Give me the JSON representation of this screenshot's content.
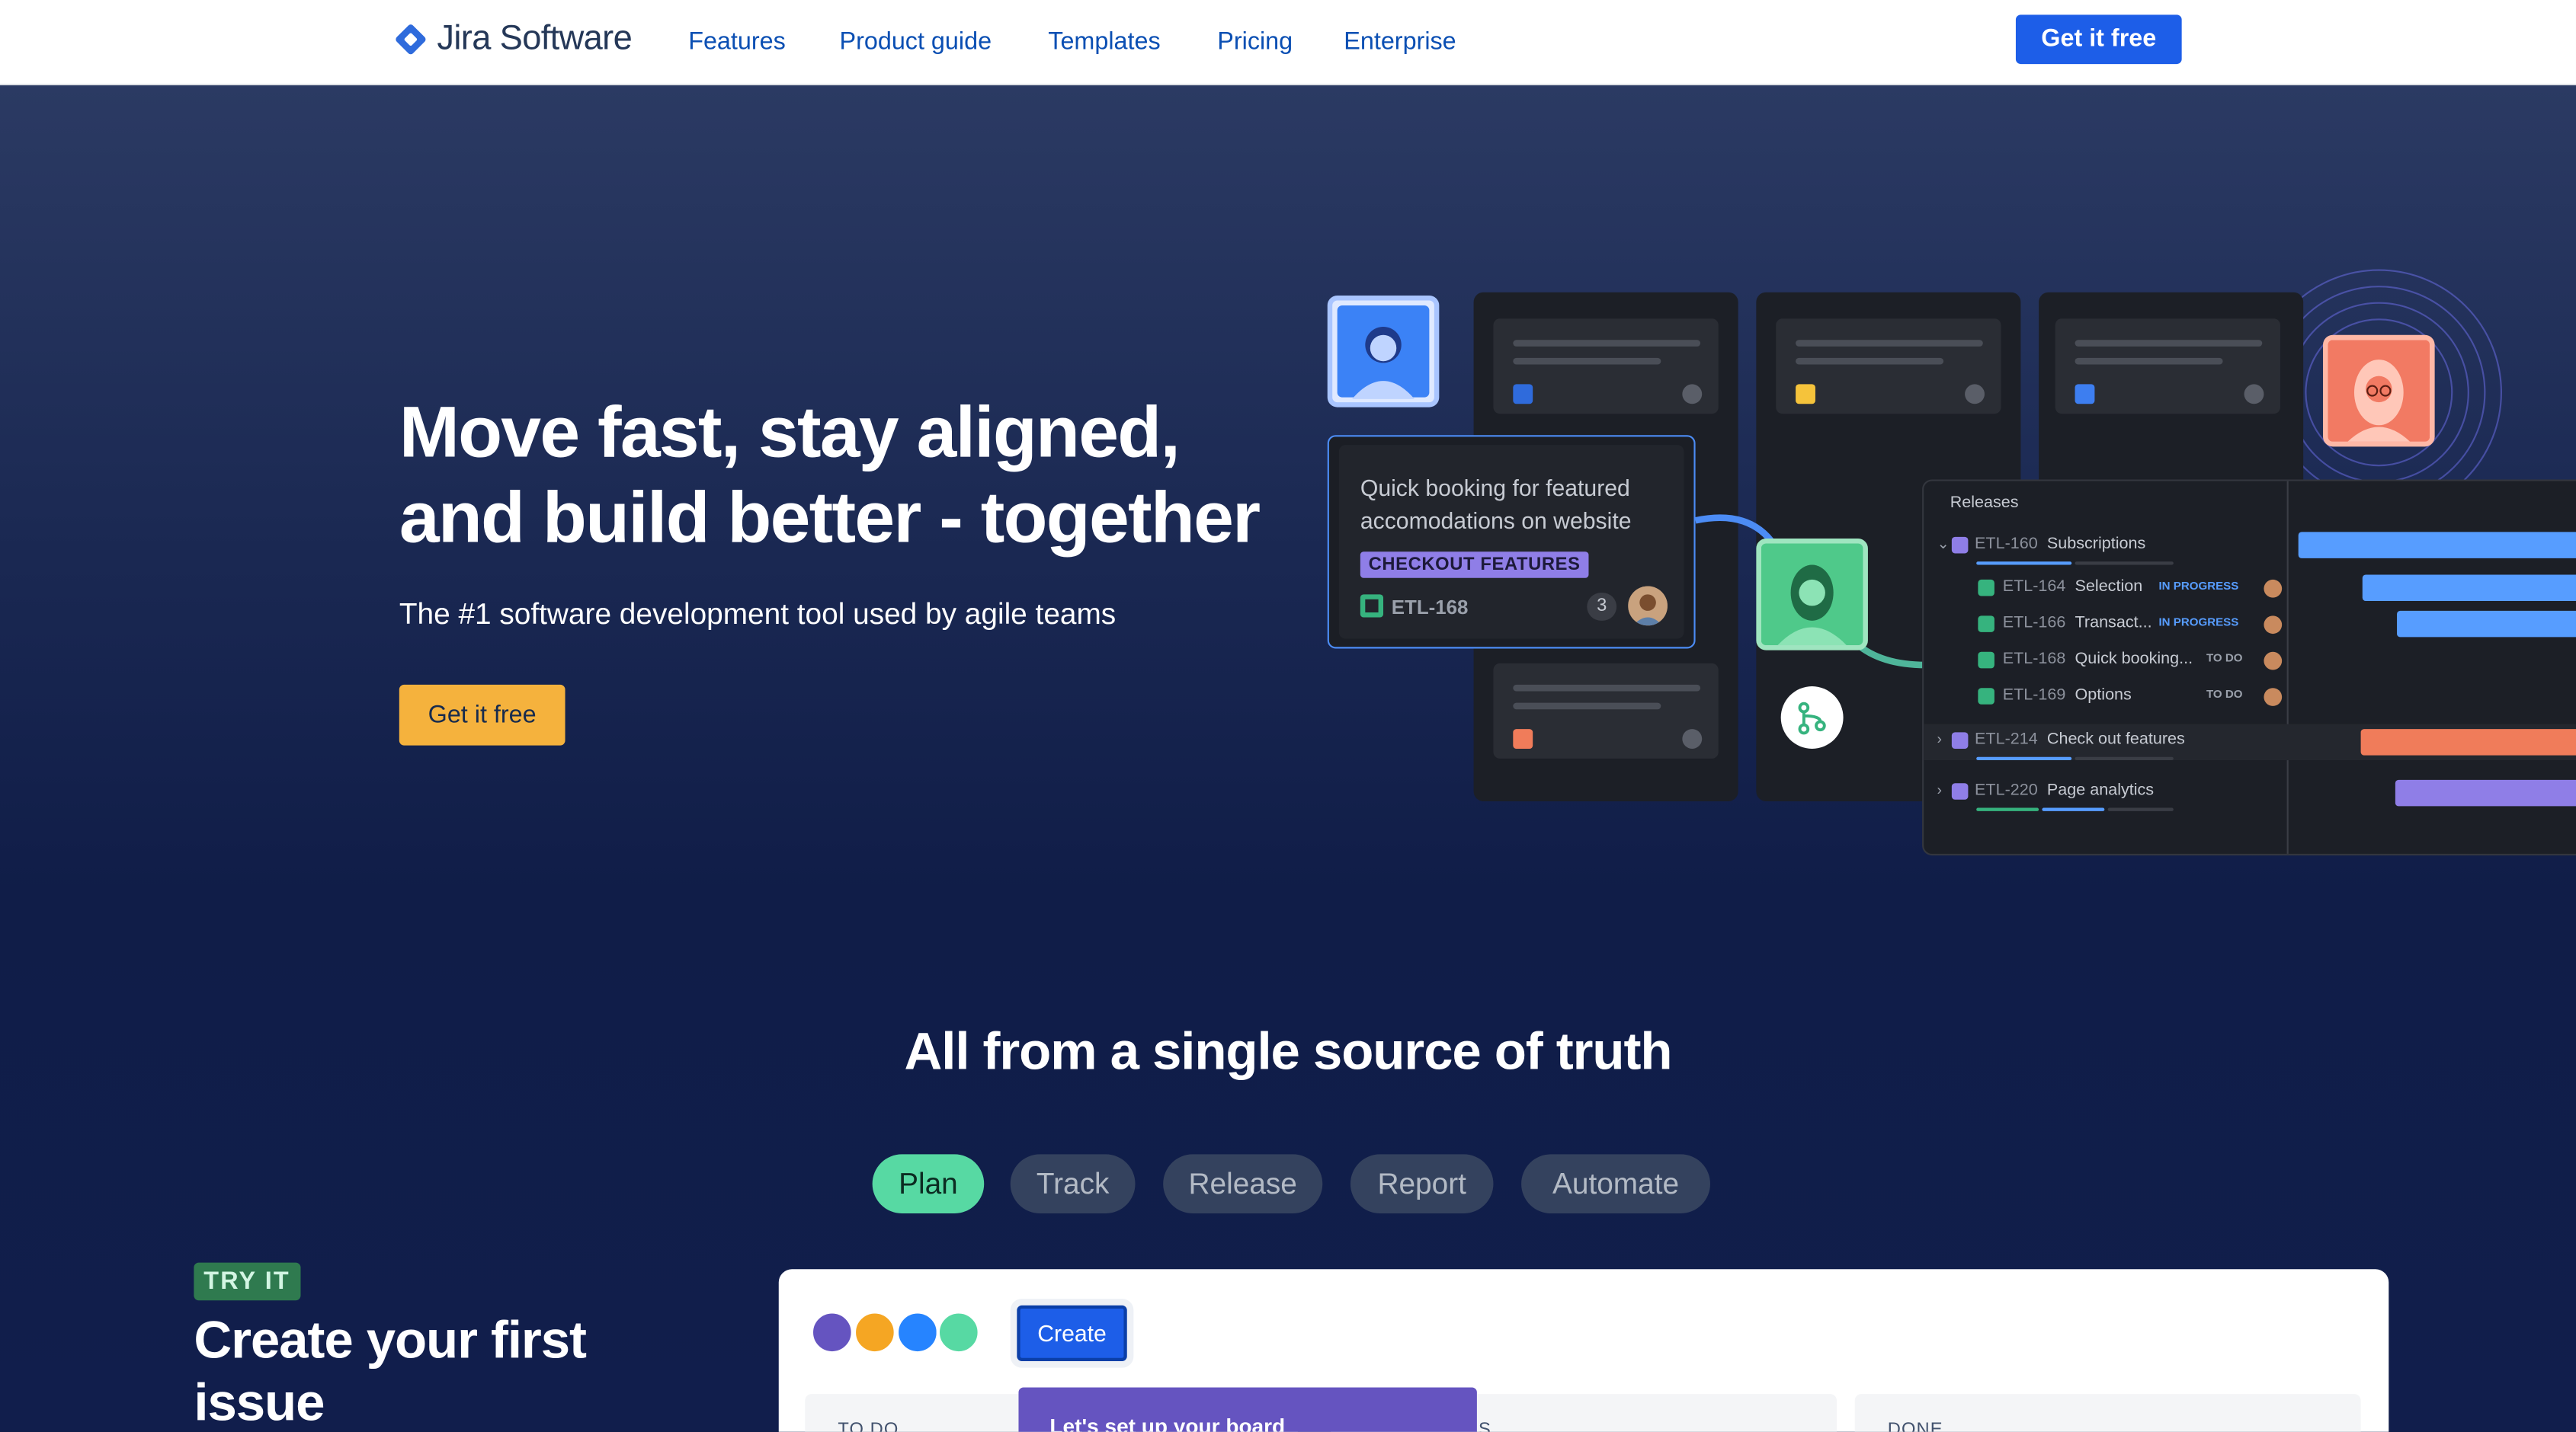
{
  "nav": {
    "logo_text": "Jira Software",
    "links": [
      "Features",
      "Product guide",
      "Templates",
      "Pricing",
      "Enterprise"
    ],
    "cta": "Get it free"
  },
  "hero": {
    "title": "Move fast, stay aligned, and build better - together",
    "subtitle": "The #1 software development tool used by agile teams",
    "cta": "Get it free"
  },
  "illustration": {
    "card": {
      "title": "Quick booking for featured accomodations on website",
      "tag": "CHECKOUT FEATURES",
      "key": "ETL-168",
      "count": "3"
    },
    "releases": {
      "heading": "Releases",
      "rows": [
        {
          "key": "ETL-160",
          "name": "Subscriptions",
          "badge": ""
        },
        {
          "key": "ETL-164",
          "name": "Selection",
          "badge": "IN PROGRESS"
        },
        {
          "key": "ETL-166",
          "name": "Transact...",
          "badge": "IN PROGRESS"
        },
        {
          "key": "ETL-168",
          "name": "Quick booking...",
          "badge": "TO DO"
        },
        {
          "key": "ETL-169",
          "name": "Options",
          "badge": "TO DO"
        },
        {
          "key": "ETL-214",
          "name": "Check out features",
          "badge": ""
        },
        {
          "key": "ETL-220",
          "name": "Page analytics",
          "badge": ""
        }
      ]
    }
  },
  "section": {
    "title": "All from a single source of truth",
    "tabs": [
      "Plan",
      "Track",
      "Release",
      "Report",
      "Automate"
    ]
  },
  "try": {
    "badge": "TRY IT",
    "title": "Create your first issue"
  },
  "demo": {
    "create": "Create",
    "columns": [
      "TO DO",
      "S",
      "DONE"
    ],
    "callout": "Let's set up your board"
  },
  "colors": {
    "brand_blue": "#1d5ee8",
    "cta_yellow": "#f5b23d",
    "tab_active": "#57d9a3",
    "tag_purple": "#8f7ee7"
  }
}
